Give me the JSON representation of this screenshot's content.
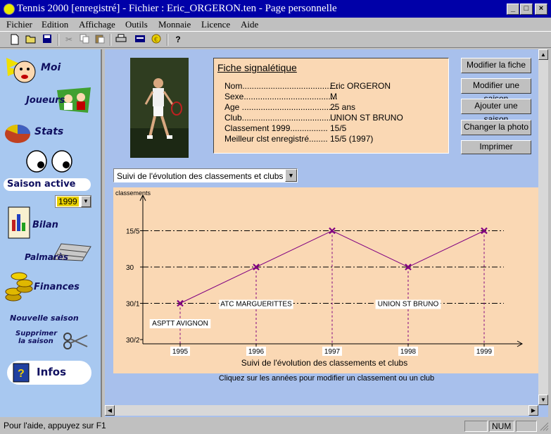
{
  "window": {
    "title": "Tennis 2000 [enregistré] - Fichier : Eric_ORGERON.ten - Page personnelle",
    "min": "_",
    "max": "□",
    "close": "×"
  },
  "menu": [
    "Fichier",
    "Edition",
    "Affichage",
    "Outils",
    "Monnaie",
    "Licence",
    "Aide"
  ],
  "toolbar": [
    "new-file-icon",
    "open-folder-icon",
    "save-icon",
    "cut-icon",
    "copy-icon",
    "paste-icon",
    "print-icon",
    "card-icon",
    "coin-icon",
    "help-icon"
  ],
  "sidebar": {
    "moi": "Moi",
    "joueurs": "Joueurs",
    "stats": "Stats",
    "saison_active": "Saison active",
    "season_value": "1999",
    "bilan": "Bilan",
    "palmares": "Palmarès",
    "finances": "Finances",
    "nouvelle_saison": "Nouvelle saison",
    "supprimer_1": "Supprimer",
    "supprimer_2": "la saison",
    "infos": "Infos"
  },
  "fiche": {
    "title": "Fiche signalétique",
    "rows": [
      {
        "label": "Nom.........................................",
        "value": "Eric ORGERON"
      },
      {
        "label": "Sexe........................................",
        "value": "M"
      },
      {
        "label": "Age .........................................",
        "value": "25 ans"
      },
      {
        "label": "Club.........................................",
        "value": "UNION ST BRUNO"
      },
      {
        "label": "Classement 1999................",
        "value": "15/5"
      },
      {
        "label": "Meilleur clst enregistré........",
        "value": "15/5 (1997)"
      }
    ]
  },
  "buttons": {
    "modifier_fiche": "Modifier la fiche",
    "modifier_saison": "Modifier une saison",
    "ajouter_saison": "Ajouter une saison",
    "changer_photo": "Changer la photo",
    "imprimer": "Imprimer"
  },
  "chart_select": "Suivi de l'évolution des classements et clubs",
  "chart_data": {
    "type": "line",
    "ylabel": "classements",
    "xlabel": "Suivi de l'évolution des classements et clubs",
    "y_categories": [
      "30/2",
      "30/1",
      "30",
      "15/5"
    ],
    "x": [
      "1995",
      "1996",
      "1997",
      "1998",
      "1999"
    ],
    "series": [
      {
        "values": [
          "30/1",
          "30",
          "15/5",
          "30",
          "15/5"
        ]
      }
    ],
    "club_labels": [
      {
        "label": "ASPTT AVIGNON",
        "from": "1995",
        "to": "1995"
      },
      {
        "label": "ATC MARGUERITTES",
        "from": "1995",
        "to": "1997"
      },
      {
        "label": "UNION ST BRUNO",
        "from": "1997",
        "to": "1999"
      }
    ],
    "colors": {
      "line": "#800080",
      "markers": "#800080",
      "gridlines": "#000000"
    }
  },
  "hint": "Cliquez sur les années pour modifier un classement ou un club",
  "status": {
    "help": "Pour l'aide, appuyez sur F1",
    "num": "NUM"
  }
}
